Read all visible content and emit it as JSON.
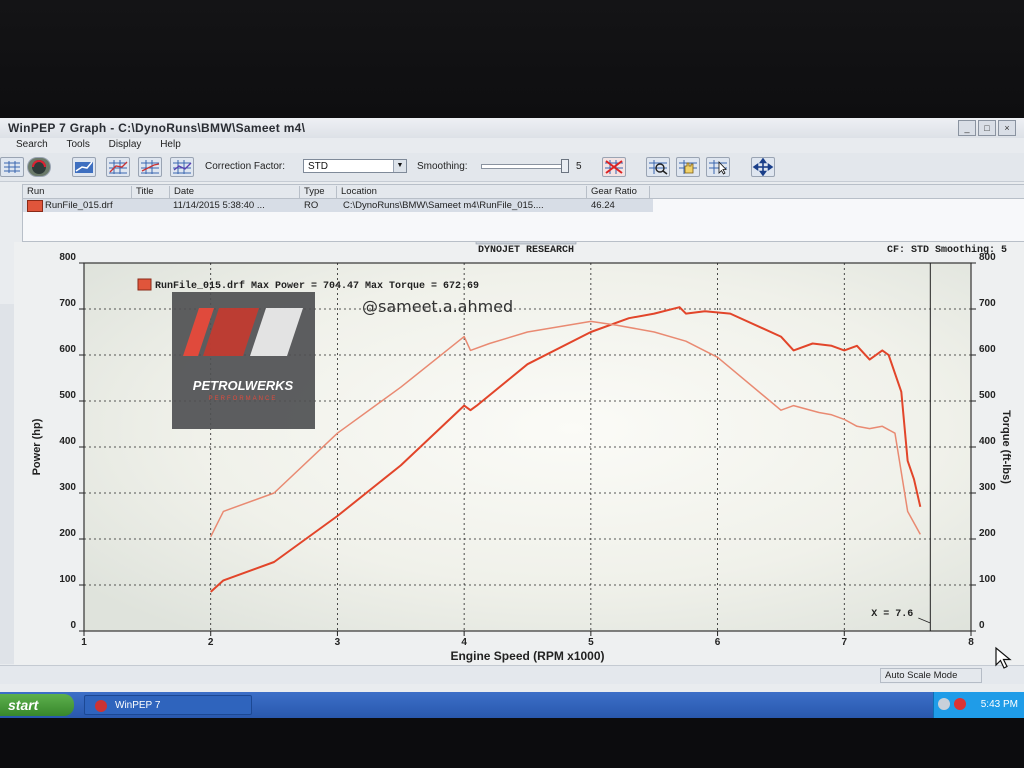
{
  "window": {
    "title": "WinPEP 7    Graph - C:\\DynoRuns\\BMW\\Sameet m4\\",
    "buttons": [
      "_",
      "□",
      "×"
    ]
  },
  "menu": [
    "Search",
    "Tools",
    "Display",
    "Help"
  ],
  "toolbar": {
    "correction_label": "Correction Factor:",
    "correction_value": "STD",
    "smoothing_label": "Smoothing:",
    "smoothing_value": "5",
    "smoothing_level": 1.0
  },
  "runs": {
    "columns": [
      "Run",
      "Title",
      "Date",
      "Type",
      "Location",
      "Gear Ratio"
    ],
    "rows": [
      {
        "run": "RunFile_015.drf",
        "title": "",
        "date": "11/14/2015 5:38:40 ...",
        "type": "RO",
        "location": "C:\\DynoRuns\\BMW\\Sameet m4\\RunFile_015....",
        "gear_ratio": "46.24"
      }
    ]
  },
  "graph_header": {
    "center": "DYNOJET RESEARCH",
    "right": "CF: STD  Smoothing: 5"
  },
  "watermark": {
    "text": "@sameet.a.ahmed",
    "logo_text": "PETROLWERKS",
    "logo_subtext": "PERFORMANCE"
  },
  "chart_data": {
    "type": "line",
    "legend": "RunFile_015.drf Max Power = 704.47 Max Torque = 672.69",
    "xlabel": "Engine Speed (RPM x1000)",
    "ylabel_left": "Power (hp)",
    "ylabel_right": "Torque (ft-lbs)",
    "xlim": [
      1,
      8
    ],
    "ylim_left": [
      0,
      800
    ],
    "ylim_right": [
      0,
      800
    ],
    "x_ticks": [
      "1",
      "2",
      "3",
      "4",
      "5",
      "6",
      "7",
      "8"
    ],
    "y_left_ticks": [
      "0",
      "100",
      "200",
      "300",
      "400",
      "500",
      "600",
      "700",
      "800"
    ],
    "y_right_ticks": [
      "0",
      "100",
      "200",
      "300",
      "400",
      "500",
      "600",
      "700",
      "800"
    ],
    "cursor_label": "X = 7.6",
    "cursor_x": 7.6,
    "grid": true,
    "series": [
      {
        "name": "Power",
        "color": "#e2452a",
        "x": [
          2.0,
          2.1,
          2.5,
          3.0,
          3.5,
          4.0,
          4.05,
          4.1,
          4.5,
          5.0,
          5.3,
          5.5,
          5.7,
          5.75,
          5.9,
          6.1,
          6.5,
          6.6,
          6.75,
          6.9,
          7.0,
          7.1,
          7.2,
          7.3,
          7.35,
          7.45,
          7.5,
          7.55,
          7.6
        ],
        "y": [
          85,
          110,
          150,
          250,
          360,
          490,
          480,
          490,
          580,
          650,
          680,
          690,
          704,
          690,
          695,
          690,
          640,
          610,
          625,
          620,
          610,
          620,
          590,
          610,
          600,
          520,
          370,
          330,
          270
        ]
      },
      {
        "name": "Torque",
        "color": "#e98a72",
        "x": [
          2.0,
          2.1,
          2.5,
          3.0,
          3.5,
          4.0,
          4.05,
          4.2,
          4.5,
          5.0,
          5.2,
          5.5,
          5.75,
          6.0,
          6.5,
          6.6,
          6.8,
          6.9,
          7.0,
          7.1,
          7.2,
          7.3,
          7.4,
          7.5,
          7.6
        ],
        "y": [
          205,
          260,
          300,
          430,
          530,
          640,
          610,
          625,
          650,
          673,
          665,
          650,
          630,
          595,
          480,
          490,
          475,
          470,
          460,
          445,
          440,
          445,
          430,
          260,
          210
        ]
      }
    ]
  },
  "status": {
    "auto_scale": "Auto Scale Mode"
  },
  "taskbar": {
    "start": "start",
    "task": "WinPEP 7",
    "clock": "5:43 PM"
  }
}
